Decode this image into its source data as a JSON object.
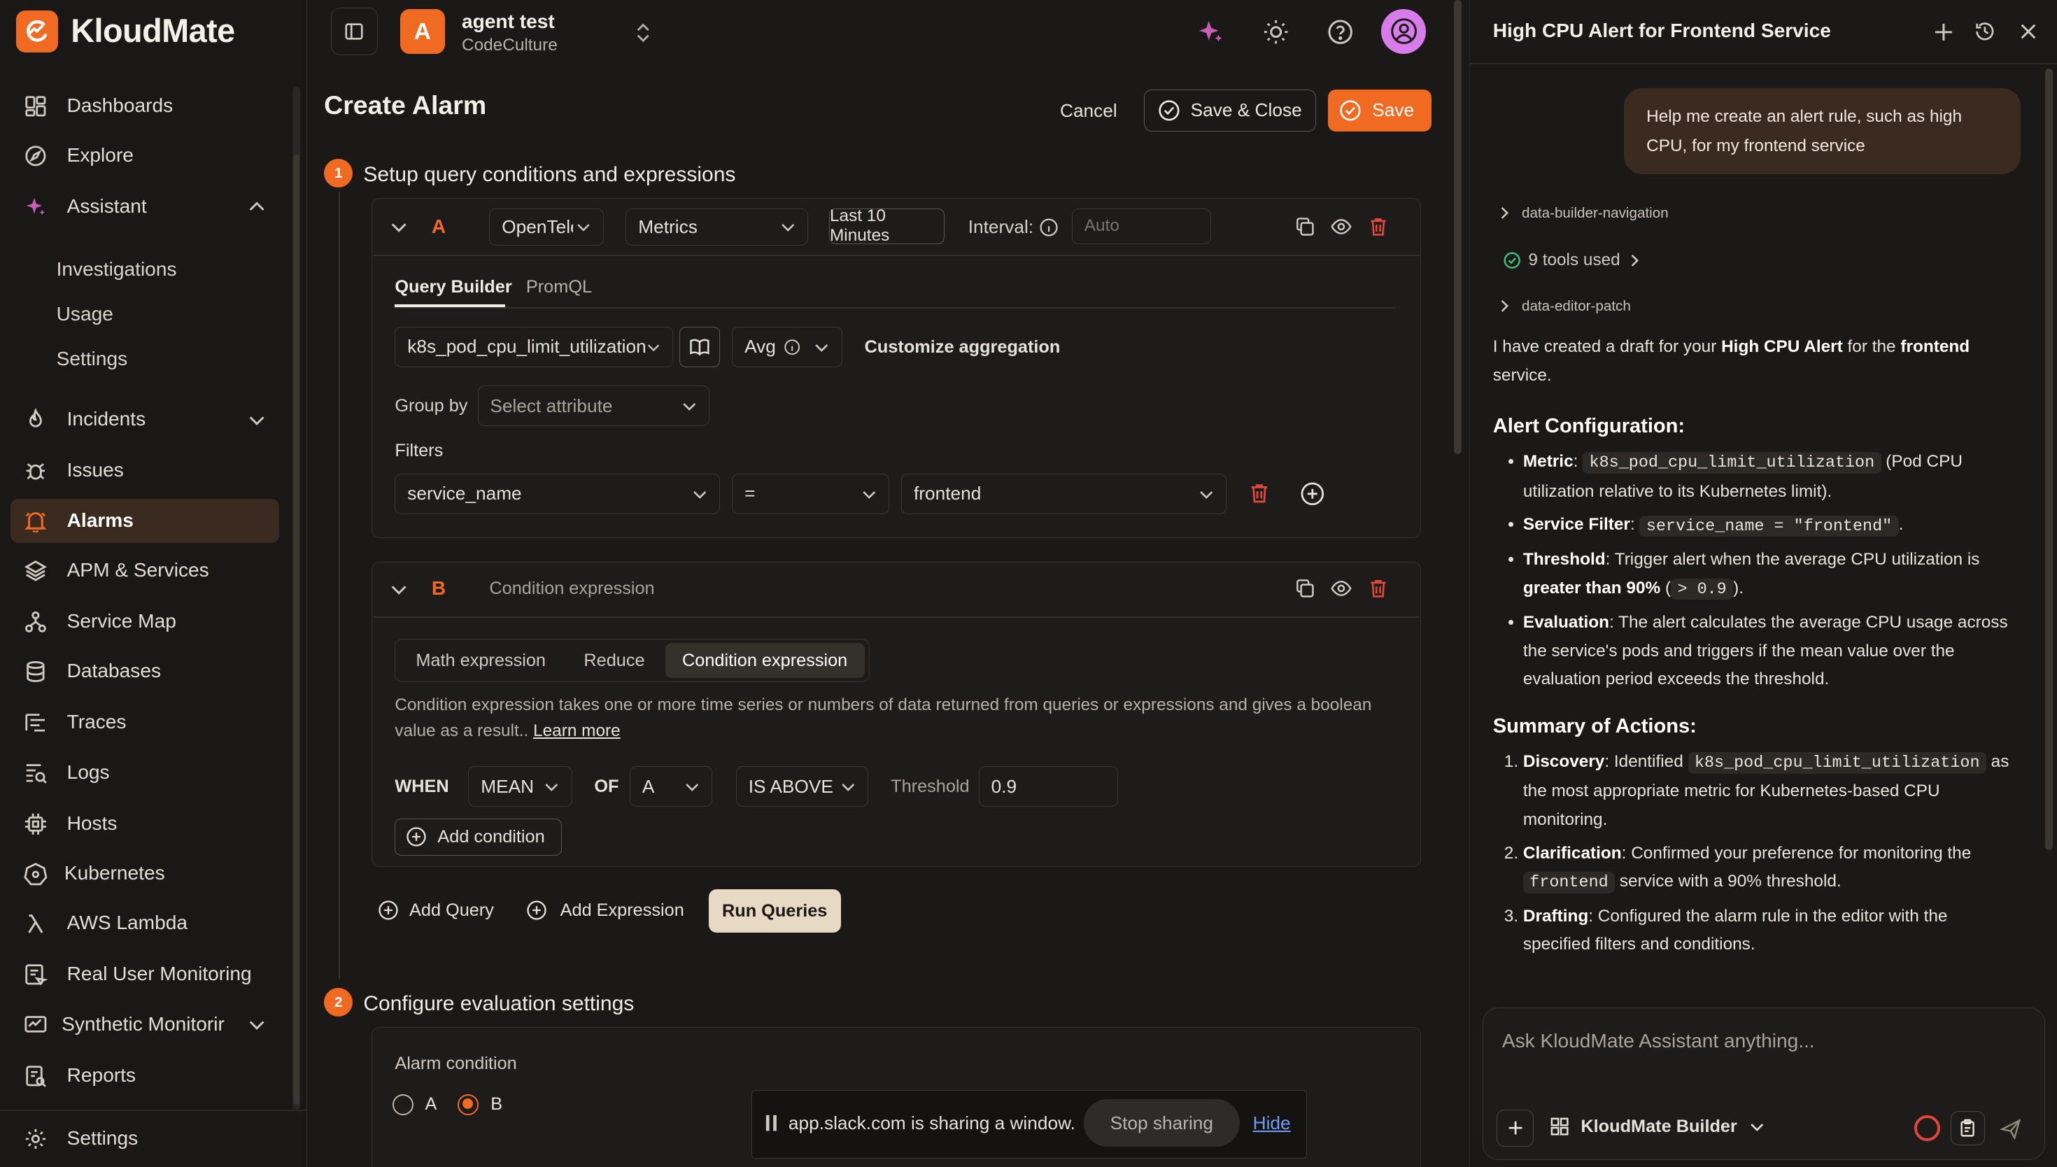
{
  "brand": {
    "name": "KloudMate",
    "accent": "#f16a21"
  },
  "sidebar": {
    "items": [
      {
        "label": "Dashboards",
        "icon": "dashboard-icon"
      },
      {
        "label": "Explore",
        "icon": "compass-icon"
      },
      {
        "label": "Assistant",
        "icon": "sparkle-icon"
      },
      {
        "label": "Incidents",
        "icon": "flame-icon"
      },
      {
        "label": "Issues",
        "icon": "bug-icon"
      },
      {
        "label": "Alarms",
        "icon": "bell-icon"
      },
      {
        "label": "APM & Services",
        "icon": "layers-icon"
      },
      {
        "label": "Service Map",
        "icon": "network-icon"
      },
      {
        "label": "Databases",
        "icon": "database-icon"
      },
      {
        "label": "Traces",
        "icon": "traces-icon"
      },
      {
        "label": "Logs",
        "icon": "logs-icon"
      },
      {
        "label": "Hosts",
        "icon": "cpu-icon"
      },
      {
        "label": "Kubernetes",
        "icon": "kubernetes-icon"
      },
      {
        "label": "AWS Lambda",
        "icon": "lambda-icon"
      },
      {
        "label": "Real User Monitoring",
        "icon": "browser-icon"
      },
      {
        "label": "Synthetic Monitorir",
        "icon": "synthetic-icon"
      },
      {
        "label": "Reports",
        "icon": "reports-icon"
      }
    ],
    "assistant_sub": [
      "Investigations",
      "Usage",
      "Settings"
    ],
    "bottom_settings": "Settings"
  },
  "header": {
    "org_initial": "A",
    "org_name": "agent test",
    "org_sub": "CodeCulture"
  },
  "page": {
    "title": "Create Alarm",
    "cancel": "Cancel",
    "save_close": "Save & Close",
    "save": "Save",
    "step1": {
      "num": "1",
      "title": "Setup query conditions and expressions"
    },
    "step2": {
      "num": "2",
      "title": "Configure evaluation settings"
    }
  },
  "queryA": {
    "letter": "A",
    "datasource": "OpenTele",
    "type": "Metrics",
    "time": "Last 10 Minutes",
    "interval_label": "Interval:",
    "interval_placeholder": "Auto",
    "tabs": [
      "Query Builder",
      "PromQL"
    ],
    "metric": "k8s_pod_cpu_limit_utilization",
    "agg": "Avg",
    "customize": "Customize aggregation",
    "group_by_label": "Group by",
    "group_by_placeholder": "Select attribute",
    "filters_label": "Filters",
    "filter_key": "service_name",
    "filter_op": "=",
    "filter_val": "frontend"
  },
  "exprB": {
    "letter": "B",
    "title": "Condition expression",
    "tabs": [
      "Math expression",
      "Reduce",
      "Condition expression"
    ],
    "desc": "Condition expression takes one or more time series or numbers of data returned from queries or expressions and gives a boolean value as a result..",
    "learn_more": "Learn more",
    "when": "WHEN",
    "reducer": "MEAN",
    "of": "OF",
    "query": "A",
    "comparator": "IS ABOVE",
    "threshold_label": "Threshold",
    "threshold": "0.9",
    "add_condition": "Add condition"
  },
  "actions": {
    "add_query": "Add Query",
    "add_expression": "Add Expression",
    "run": "Run Queries"
  },
  "eval": {
    "alarm_condition": "Alarm condition",
    "opt_a": "A",
    "opt_b": "B",
    "selected": "B"
  },
  "banner": {
    "text": "app.slack.com is sharing a window.",
    "stop": "Stop sharing",
    "hide": "Hide"
  },
  "chat": {
    "title": "High CPU Alert for Frontend Service",
    "user_msg": "Help me create an alert rule, such as high CPU, for my frontend service",
    "tool1": "data-builder-navigation",
    "tools_used": "9 tools used",
    "tool2": "data-editor-patch",
    "intro_1": "I have created a draft for your ",
    "intro_b1": "High CPU Alert",
    "intro_2": " for the ",
    "intro_b2": "frontend",
    "intro_3": " service.",
    "h_config": "Alert Configuration:",
    "cfg_metric_k": "Metric",
    "cfg_metric_code": "k8s_pod_cpu_limit_utilization",
    "cfg_metric_rest": " (Pod CPU utilization relative to its Kubernetes limit).",
    "cfg_filter_k": "Service Filter",
    "cfg_filter_code": "service_name = \"frontend\"",
    "cfg_thr_k": "Threshold",
    "cfg_thr_rest": ": Trigger alert when the average CPU utilization is ",
    "cfg_thr_b": "greater than 90%",
    "cfg_thr_code": "> 0.9",
    "cfg_eval_k": "Evaluation",
    "cfg_eval_rest": ": The alert calculates the average CPU usage across the service's pods and triggers if the mean value over the evaluation period exceeds the threshold.",
    "h_summary": "Summary of Actions:",
    "s1_k": "Discovery",
    "s1_a": ": Identified ",
    "s1_code": "k8s_pod_cpu_limit_utilization",
    "s1_b": " as the most appropriate metric for Kubernetes-based CPU monitoring.",
    "s2_k": "Clarification",
    "s2_a": ": Confirmed your preference for monitoring the ",
    "s2_code": "frontend",
    "s2_b": " service with a 90% threshold.",
    "s3_k": "Drafting",
    "s3_a": ": Configured the alarm rule in the editor with the specified filters and conditions.",
    "input_placeholder": "Ask KloudMate Assistant anything...",
    "mode": "KloudMate Builder"
  }
}
